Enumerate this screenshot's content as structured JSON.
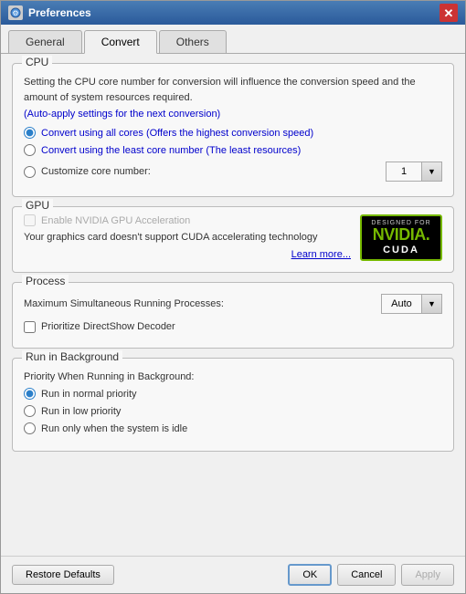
{
  "window": {
    "title": "Preferences",
    "close_label": "✕"
  },
  "tabs": [
    {
      "id": "general",
      "label": "General",
      "active": false
    },
    {
      "id": "convert",
      "label": "Convert",
      "active": true
    },
    {
      "id": "others",
      "label": "Others",
      "active": false
    }
  ],
  "cpu_section": {
    "label": "CPU",
    "info_text": "Setting the CPU core number for conversion will influence the conversion speed and the amount of system resources required.",
    "auto_apply_text": "(Auto-apply settings for the next conversion)",
    "options": [
      {
        "id": "all_cores",
        "label": "Convert using all cores (Offers the highest conversion speed)",
        "checked": true
      },
      {
        "id": "least_cores",
        "label": "Convert using the least core number (The least resources)",
        "checked": false
      },
      {
        "id": "customize",
        "label": "Customize core number:",
        "checked": false
      }
    ],
    "core_value": "1"
  },
  "gpu_section": {
    "label": "GPU",
    "checkbox_label": "Enable NVIDIA GPU Acceleration",
    "checkbox_disabled": true,
    "info_text": "Your graphics card doesn't support CUDA accelerating technology",
    "learn_more": "Learn more...",
    "badge": {
      "designed_for": "DESIGNED FOR",
      "brand": "NVIDIA.",
      "sub": "CUDA"
    }
  },
  "process_section": {
    "label": "Process",
    "max_label": "Maximum Simultaneous Running Processes:",
    "max_value": "Auto",
    "directshow_label": "Prioritize DirectShow Decoder"
  },
  "background_section": {
    "label": "Run in Background",
    "priority_label": "Priority When Running in Background:",
    "options": [
      {
        "id": "normal",
        "label": "Run in normal priority",
        "checked": true
      },
      {
        "id": "low",
        "label": "Run in low priority",
        "checked": false
      },
      {
        "id": "idle",
        "label": "Run only when the system is idle",
        "checked": false
      }
    ]
  },
  "footer": {
    "restore_label": "Restore Defaults",
    "ok_label": "OK",
    "cancel_label": "Cancel",
    "apply_label": "Apply"
  }
}
